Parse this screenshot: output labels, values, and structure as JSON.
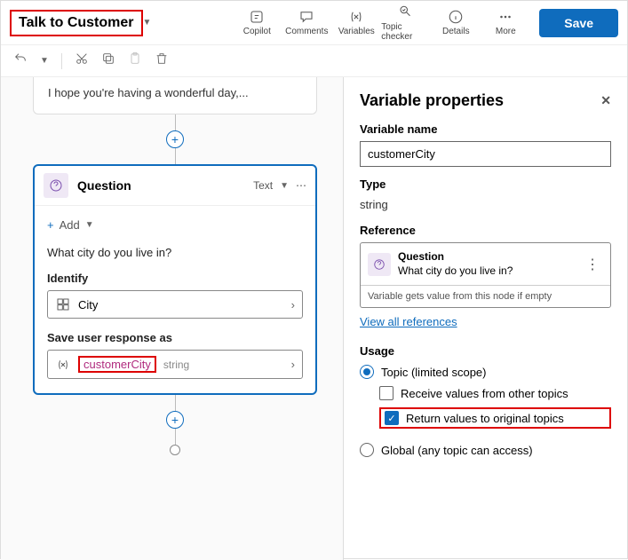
{
  "header": {
    "topic_name": "Talk to Customer",
    "buttons": {
      "copilot": "Copilot",
      "comments": "Comments",
      "variables": "Variables",
      "topic_checker": "Topic checker",
      "details": "Details",
      "more": "More",
      "save": "Save"
    }
  },
  "canvas": {
    "message_preview": "I hope you're having a wonderful day,...",
    "question_node": {
      "title": "Question",
      "type_badge": "Text",
      "add_label": "Add",
      "prompt": "What city do you live in?",
      "identify_label": "Identify",
      "identify_value": "City",
      "save_as_label": "Save user response as",
      "var_name": "customerCity",
      "var_type": "string"
    }
  },
  "side": {
    "title": "Variable properties",
    "name_label": "Variable name",
    "name_value": "customerCity",
    "type_label": "Type",
    "type_value": "string",
    "reference_label": "Reference",
    "ref_title": "Question",
    "ref_sub": "What city do you live in?",
    "ref_note": "Variable gets value from this node if empty",
    "view_all": "View all references",
    "usage_label": "Usage",
    "usage_topic": "Topic (limited scope)",
    "receive": "Receive values from other topics",
    "return": "Return values to original topics",
    "global": "Global (any topic can access)"
  }
}
